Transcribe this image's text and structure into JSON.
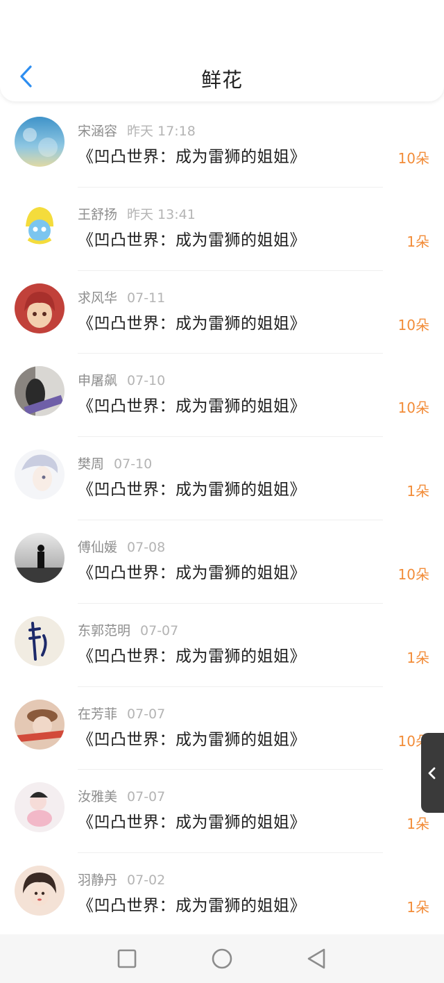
{
  "header": {
    "title": "鲜花"
  },
  "items": [
    {
      "name": "宋涵容",
      "time": "昨天 17:18",
      "book": "《凹凸世界：成为雷狮的姐姐》",
      "count": "10朵"
    },
    {
      "name": "王舒扬",
      "time": "昨天 13:41",
      "book": "《凹凸世界：成为雷狮的姐姐》",
      "count": "1朵"
    },
    {
      "name": "求风华",
      "time": "07-11",
      "book": "《凹凸世界：成为雷狮的姐姐》",
      "count": "10朵"
    },
    {
      "name": "申屠飙",
      "time": "07-10",
      "book": "《凹凸世界：成为雷狮的姐姐》",
      "count": "10朵"
    },
    {
      "name": "樊周",
      "time": "07-10",
      "book": "《凹凸世界：成为雷狮的姐姐》",
      "count": "1朵"
    },
    {
      "name": "傅仙媛",
      "time": "07-08",
      "book": "《凹凸世界：成为雷狮的姐姐》",
      "count": "10朵"
    },
    {
      "name": "东郭范明",
      "time": "07-07",
      "book": "《凹凸世界：成为雷狮的姐姐》",
      "count": "1朵"
    },
    {
      "name": "在芳菲",
      "time": "07-07",
      "book": "《凹凸世界：成为雷狮的姐姐》",
      "count": "10朵"
    },
    {
      "name": "汝雅美",
      "time": "07-07",
      "book": "《凹凸世界：成为雷狮的姐姐》",
      "count": "1朵"
    },
    {
      "name": "羽静丹",
      "time": "07-02",
      "book": "《凹凸世界：成为雷狮的姐姐》",
      "count": "1朵"
    }
  ],
  "colors": {
    "accent": "#f28c38",
    "back": "#2e8ef0"
  },
  "icons": {
    "back": "chevron-left-icon",
    "side_tab": "chevron-left-icon"
  }
}
